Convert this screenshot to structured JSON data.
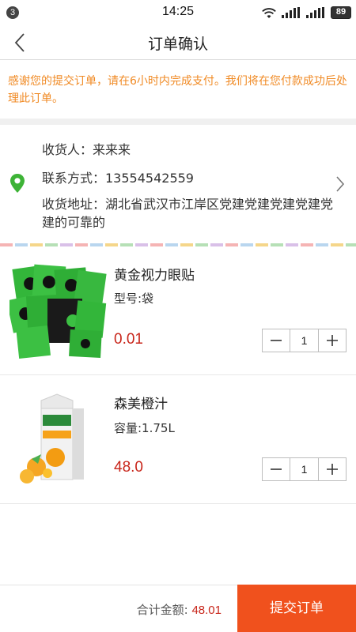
{
  "status_bar": {
    "notification_count": "3",
    "time": "14:25",
    "battery": "89"
  },
  "header": {
    "title": "订单确认"
  },
  "notice": "感谢您的提交订单，请在6小时内完成支付。我们将在您付款成功后处理此订单。",
  "address": {
    "recipient": "收货人：来来来",
    "phone": "联系方式：13554542559",
    "address": "收货地址：湖北省武汉市江岸区党建党建党建党建党建的可靠的"
  },
  "products": [
    {
      "name": "黄金视力眼贴",
      "spec": "型号:袋",
      "price": "0.01",
      "quantity": "1"
    },
    {
      "name": "森美橙汁",
      "spec": "容量:1.75L",
      "price": "48.0",
      "quantity": "1"
    }
  ],
  "footer": {
    "total_label": "合计金额: ",
    "total_value": "48.01",
    "submit_label": "提交订单"
  },
  "colors": {
    "accent": "#f0511d",
    "price": "#c8251a",
    "notice": "#f08a24",
    "pin": "#3db336"
  }
}
